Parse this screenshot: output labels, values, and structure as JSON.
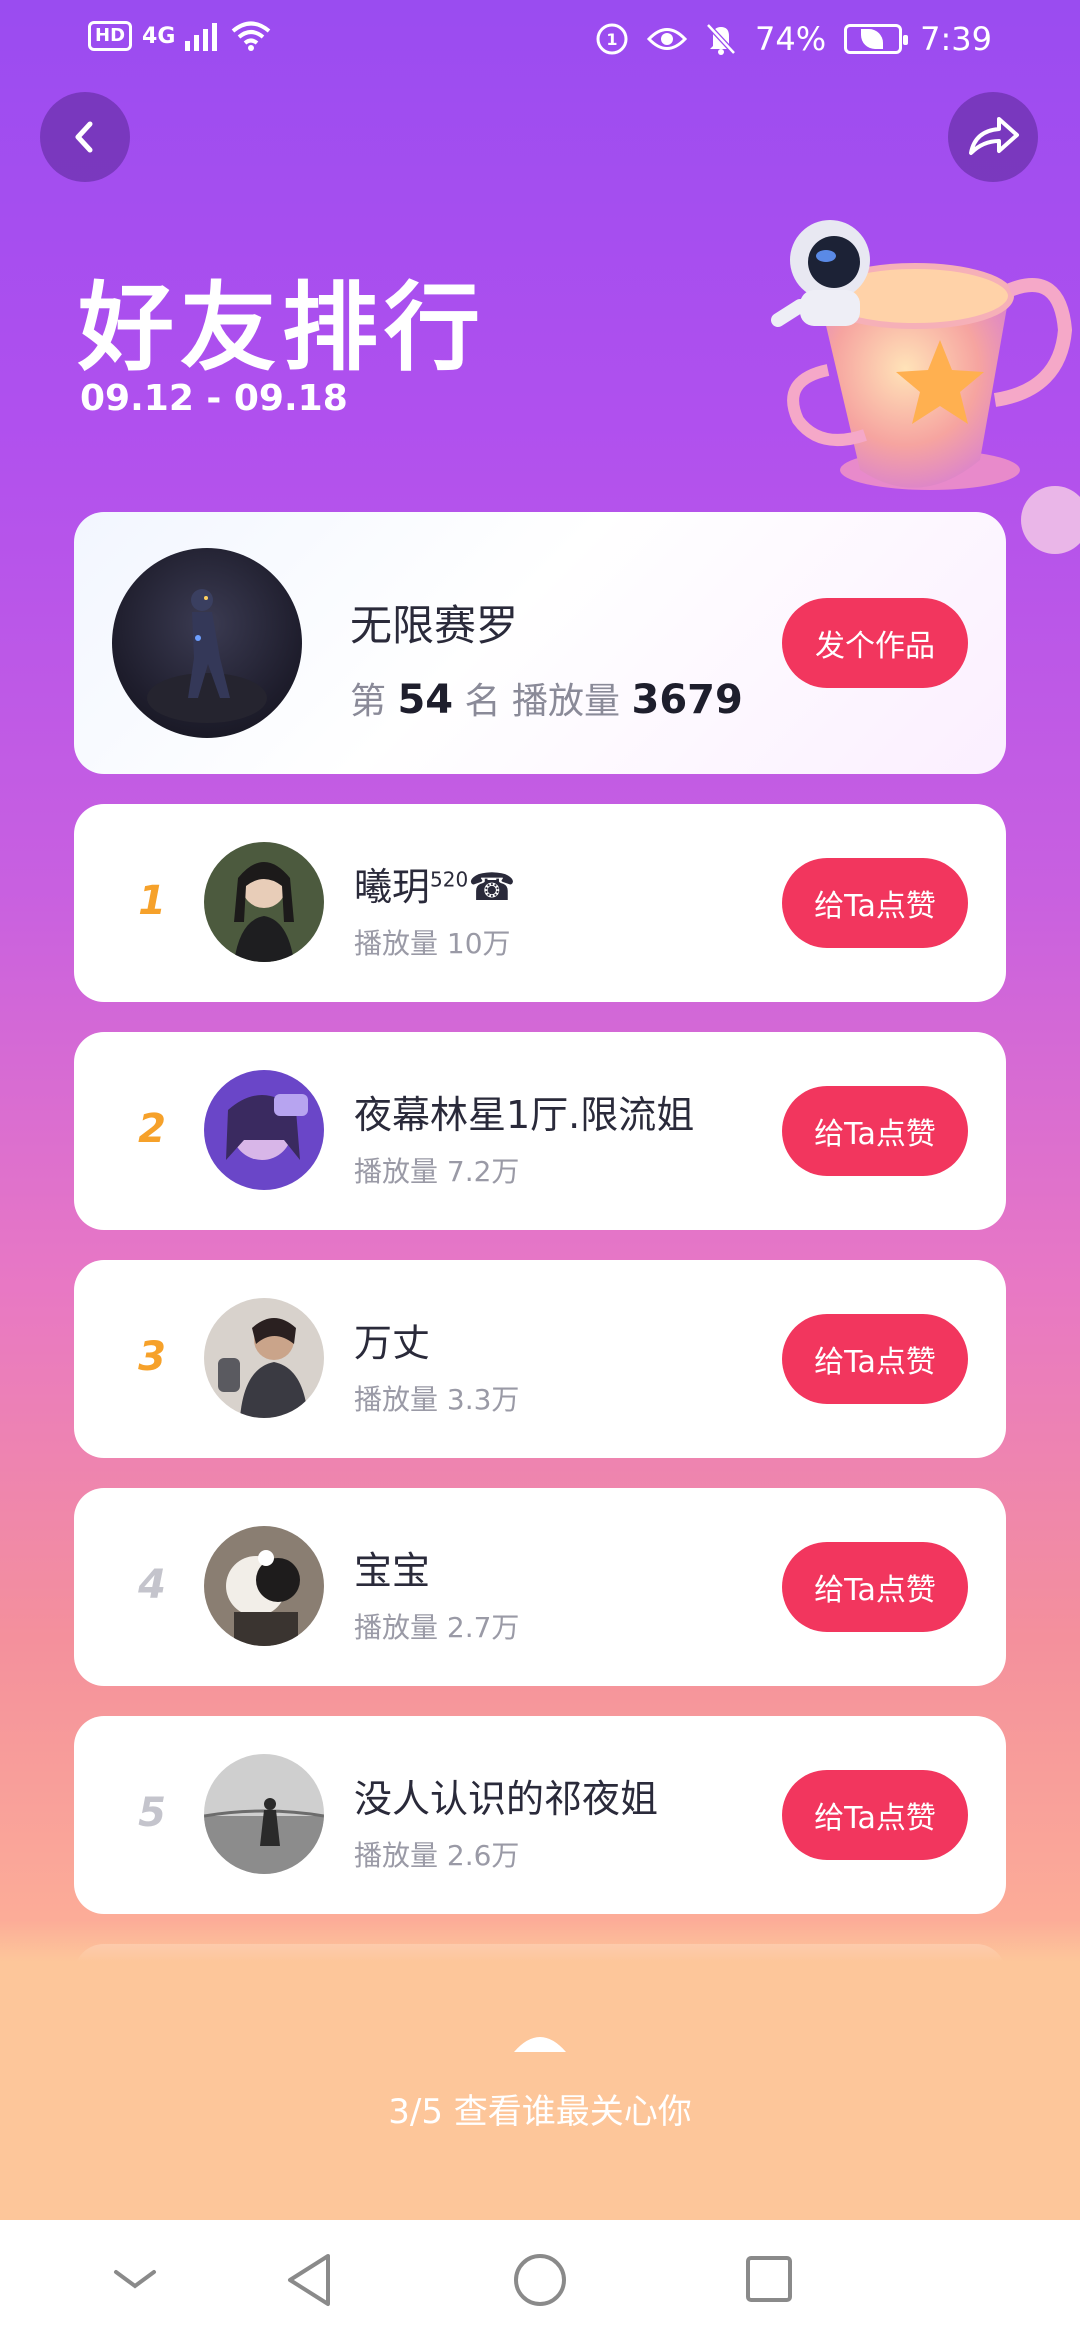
{
  "status_bar": {
    "network": "4G",
    "battery_percent": "74%",
    "time": "7:39"
  },
  "header": {
    "title": "好友排行",
    "date_range": "09.12 - 09.18"
  },
  "me": {
    "name": "无限赛罗",
    "rank_prefix": "第",
    "rank": "54",
    "rank_suffix": "名 播放量",
    "plays": "3679",
    "action": "发个作品"
  },
  "friends": [
    {
      "rank": "1",
      "name": "曦玥",
      "name_sup": "520",
      "name_icon": "☎",
      "plays": "播放量 10万",
      "action": "给Ta点赞",
      "rank_color": "#f6a12a"
    },
    {
      "rank": "2",
      "name": "夜幕林星1厅.限流姐",
      "plays": "播放量 7.2万",
      "action": "给Ta点赞",
      "rank_color": "#f6a12a"
    },
    {
      "rank": "3",
      "name": "万丈",
      "plays": "播放量 3.3万",
      "action": "给Ta点赞",
      "rank_color": "#f6a12a"
    },
    {
      "rank": "4",
      "name": "宝宝",
      "plays": "播放量 2.7万",
      "action": "给Ta点赞",
      "rank_color": "#c4c4cc"
    },
    {
      "rank": "5",
      "name": "没人认识的祁夜姐",
      "plays": "播放量 2.6万",
      "action": "给Ta点赞",
      "rank_color": "#c4c4cc"
    }
  ],
  "bottom": {
    "text": "3/5 查看谁最关心你"
  },
  "colors": {
    "accent_button": "#f2365e",
    "top_gradient": "#9a4cf0",
    "bottom_gradient": "#fcc49a"
  }
}
